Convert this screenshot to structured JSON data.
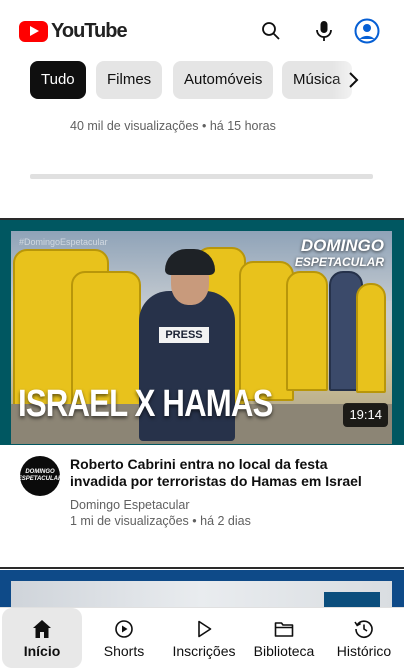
{
  "header": {
    "logo_text": "YouTube",
    "icons": [
      "search-icon",
      "microphone-icon",
      "account-icon"
    ]
  },
  "chips": [
    {
      "label": "Tudo",
      "active": true
    },
    {
      "label": "Filmes",
      "active": false
    },
    {
      "label": "Automóveis",
      "active": false
    },
    {
      "label": "Música",
      "active": false
    }
  ],
  "previous_video": {
    "meta": "40 mil de visualizações • há 15 horas"
  },
  "video": {
    "thumbnail_text": "ISRAEL X HAMAS",
    "thumbnail_watermark": "#DomingoEspetacular",
    "thumbnail_brand_line1": "DOMINGO",
    "thumbnail_brand_line2": "ESPETACULAR",
    "thumbnail_press_label": "PRESS",
    "duration": "19:14",
    "avatar_text_line1": "DOMINGO",
    "avatar_text_line2": "ESPETACULAR",
    "title": "Roberto Cabrini entra no local da festa invadida por terroristas do Hamas em Israel",
    "channel": "Domingo Espetacular",
    "meta": "1 mi de visualizações • há 2 dias"
  },
  "bottom_nav": [
    {
      "label": "Início",
      "icon": "home-icon",
      "active": true
    },
    {
      "label": "Shorts",
      "icon": "shorts-icon",
      "active": false
    },
    {
      "label": "Inscrições",
      "icon": "subscriptions-icon",
      "active": false
    },
    {
      "label": "Biblioteca",
      "icon": "library-icon",
      "active": false
    },
    {
      "label": "Histórico",
      "icon": "history-icon",
      "active": false
    }
  ],
  "colors": {
    "brand_red": "#ff0000",
    "chip_active_bg": "#0f0f0f",
    "chip_bg": "#e5e5e5",
    "account_blue": "#065fd4",
    "thumb_frame": "#005761"
  }
}
